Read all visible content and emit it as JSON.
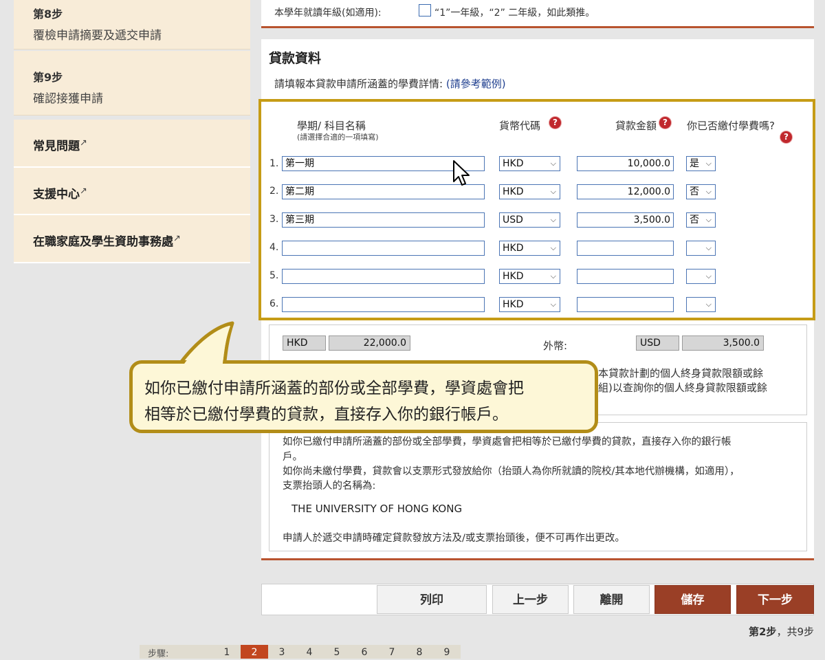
{
  "sidebar": {
    "steps": [
      {
        "num": "第8步",
        "label": "覆檢申請摘要及遞交申請"
      },
      {
        "num": "第9步",
        "label": "確認接獲申請"
      }
    ],
    "links": [
      {
        "label": "常見問題"
      },
      {
        "label": "支援中心"
      },
      {
        "label": "在職家庭及學生資助事務處"
      }
    ]
  },
  "grade": {
    "label": "本學年就讀年級(如適用):",
    "hint": "“1”一年級，“2” 二年級，如此類推。"
  },
  "loan": {
    "title": "貸款資料",
    "desc": "請填報本貸款申請所涵蓋的學費詳情:",
    "example_link": "(請參考範例)",
    "headers": {
      "term": "學期/ 科目名稱",
      "term_sub": "(請選擇合適的一項填寫)",
      "currency": "貨幣代碼",
      "amount": "貸款金額",
      "paid": "你已否繳付學費嗎?"
    },
    "help_glyph": "?",
    "rows": [
      {
        "num": "1.",
        "term": "第一期",
        "currency": "HKD",
        "amount": "10,000.0",
        "paid": "是"
      },
      {
        "num": "2.",
        "term": "第二期",
        "currency": "HKD",
        "amount": "12,000.0",
        "paid": "否"
      },
      {
        "num": "3.",
        "term": "第三期",
        "currency": "USD",
        "amount": "3,500.0",
        "paid": "否"
      },
      {
        "num": "4.",
        "term": "",
        "currency": "HKD",
        "amount": "",
        "paid": ""
      },
      {
        "num": "5.",
        "term": "",
        "currency": "HKD",
        "amount": "",
        "paid": ""
      },
      {
        "num": "6.",
        "term": "",
        "currency": "HKD",
        "amount": "",
        "paid": ""
      }
    ]
  },
  "totals": {
    "local_currency": "HKD",
    "local_total": "22,000.0",
    "foreign_label": "外幣:",
    "foreign_currency": "USD",
    "foreign_total": "3,500.0",
    "note_line1": "本貸款計劃的個人終身貸款限額或餘",
    "note_line2": "組)以查詢你的個人終身貸款限額或餘"
  },
  "info": {
    "line1": "如你已繳付申請所涵蓋的部份或全部學費，學資處會把相等於已繳付學費的貸款，直接存入你的銀行帳",
    "line2": "戶。",
    "line3": "如你尚未繳付學費，貸款會以支票形式發放給你（抬頭人為你所就讀的院校/其本地代辦機構，如適用），",
    "line4": "支票抬頭人的名稱為:",
    "payee": "THE UNIVERSITY OF HONG KONG",
    "line5": "申請人於遞交申請時確定貸款發放方法及/或支票抬頭後，便不可再作出更改。"
  },
  "buttons": {
    "print": "列印",
    "prev": "上一步",
    "leave": "離開",
    "save": "儲存",
    "next": "下一步"
  },
  "progress": {
    "current": "第2步",
    "separator": "，",
    "total": "共9步"
  },
  "pager": {
    "label": "步驟:",
    "pages": [
      "1",
      "2",
      "3",
      "4",
      "5",
      "6",
      "7",
      "8",
      "9"
    ],
    "current": "2"
  },
  "bubble": {
    "line1": "如你已繳付申請所涵蓋的部份或全部學費，學資處會把",
    "line2": "相等於已繳付學費的貸款，直接存入你的銀行帳戶。"
  },
  "colors": {
    "accent": "#9a3f26",
    "rule": "#b8532e",
    "highlight_border": "#c69c16",
    "sidebar_bg": "#f8ecd8"
  }
}
